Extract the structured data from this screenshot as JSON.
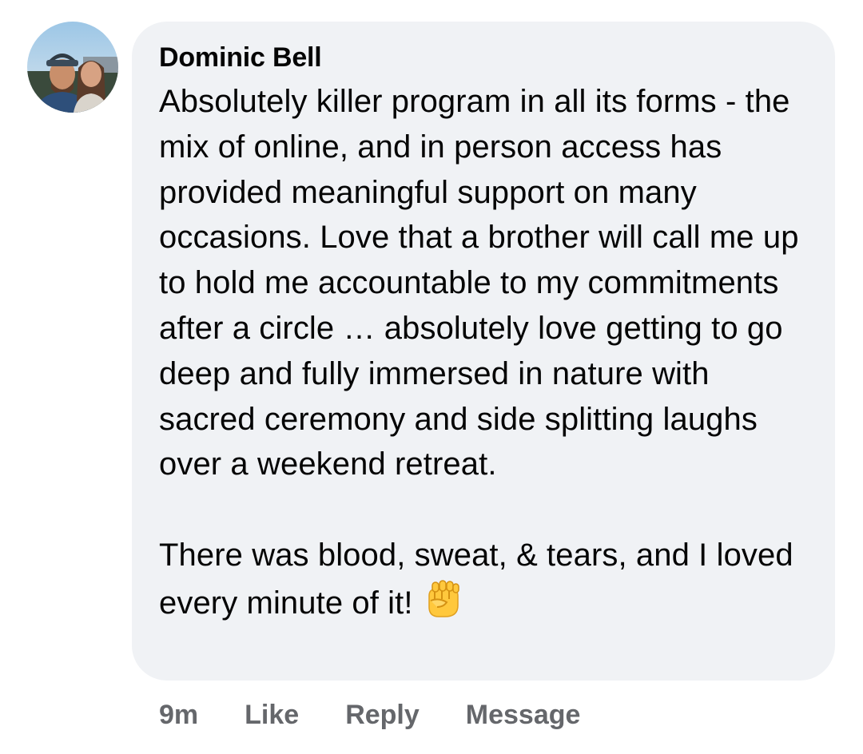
{
  "comment": {
    "author": "Dominic Bell",
    "paragraph_1": "Absolutely killer program in all its forms - the mix of online, and in person access has provided meaningful support on many occasions. Love that a brother will call me up to hold me accountable to my commitments after a circle … absolutely love getting to go deep and fully immersed in nature with sacred ceremony and side splitting laughs over a weekend retreat.",
    "paragraph_2": "There was blood, sweat, & tears, and I loved every minute of it!",
    "emoji": "raised-fist-icon"
  },
  "actions": {
    "time": "9m",
    "like": "Like",
    "reply": "Reply",
    "message": "Message"
  },
  "colors": {
    "bubble_bg": "#f0f2f5",
    "text": "#050505",
    "secondary_text": "#65676b",
    "emoji_fill": "#ffc83d"
  }
}
